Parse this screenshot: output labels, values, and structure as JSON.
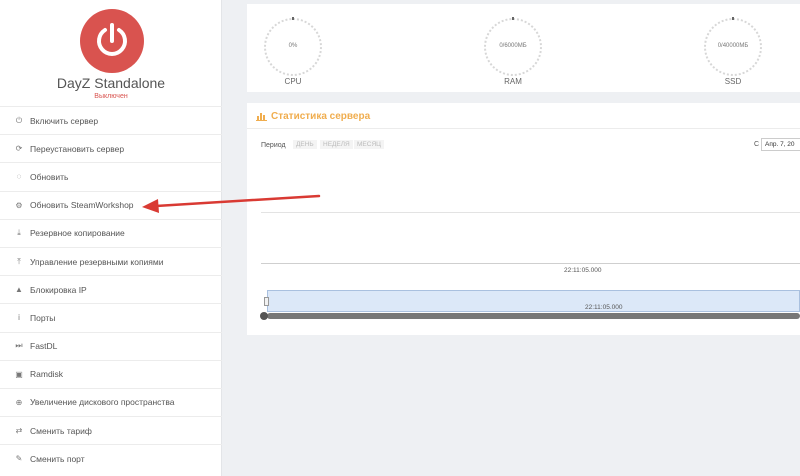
{
  "sidebar": {
    "server_name": "DayZ Standalone",
    "server_status": "Выключен",
    "items": [
      {
        "label": "Включить сервер",
        "icon": "power-icon"
      },
      {
        "label": "Переустановить сервер",
        "icon": "refresh-icon"
      },
      {
        "label": "Обновить",
        "icon": "spinner-icon"
      },
      {
        "label": "Обновить SteamWorkshop",
        "icon": "steam-icon"
      },
      {
        "label": "Резервное копирование",
        "icon": "download-icon"
      },
      {
        "label": "Управление резервными копиями",
        "icon": "upload-icon"
      },
      {
        "label": "Блокировка IP",
        "icon": "warning-icon"
      },
      {
        "label": "Порты",
        "icon": "info-icon"
      },
      {
        "label": "FastDL",
        "icon": "fast-forward-icon"
      },
      {
        "label": "Ramdisk",
        "icon": "floppy-icon"
      },
      {
        "label": "Увеличение дискового пространства",
        "icon": "plus-circle-icon"
      },
      {
        "label": "Сменить тариф",
        "icon": "exchange-icon"
      },
      {
        "label": "Сменить порт",
        "icon": "edit-icon"
      }
    ]
  },
  "stats": {
    "cpu": {
      "value": "0%",
      "label": "CPU"
    },
    "ram": {
      "value": "0/6000МБ",
      "label": "RAM"
    },
    "ssd": {
      "value": "0/40000МБ",
      "label": "SSD"
    }
  },
  "chart": {
    "title": "Статистика сервера",
    "period_label": "Период",
    "period_day": "ДЕНЬ",
    "period_week": "НЕДЕЛЯ",
    "period_month": "МЕСЯЦ",
    "from_label": "С",
    "date_value": "Апр. 7, 20",
    "x_tick": "22:11:05.000",
    "navigator_tick": "22:11:05.000"
  },
  "colors": {
    "power_red": "#d9534f",
    "title_orange": "#f0ad4e",
    "arrow_red": "#d93a33"
  }
}
